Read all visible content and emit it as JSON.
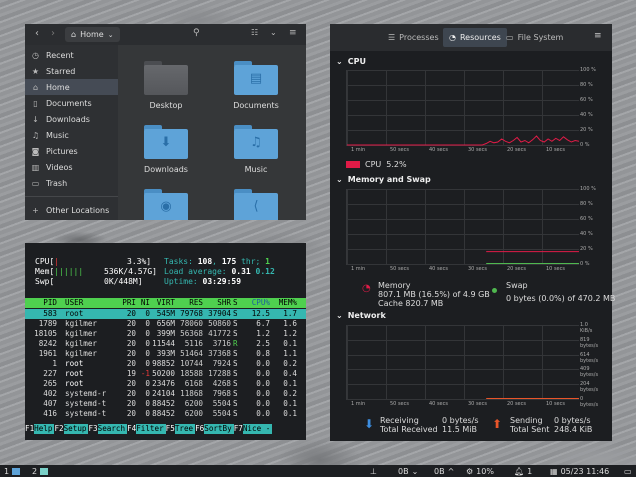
{
  "files": {
    "path_label": "Home",
    "sidebar": [
      {
        "label": "Recent",
        "icon": "clock-icon"
      },
      {
        "label": "Starred",
        "icon": "star-icon"
      },
      {
        "label": "Home",
        "icon": "home-icon",
        "selected": true
      },
      {
        "label": "Documents",
        "icon": "document-icon"
      },
      {
        "label": "Downloads",
        "icon": "download-icon"
      },
      {
        "label": "Music",
        "icon": "music-icon"
      },
      {
        "label": "Pictures",
        "icon": "camera-icon"
      },
      {
        "label": "Videos",
        "icon": "video-icon"
      },
      {
        "label": "Trash",
        "icon": "trash-icon"
      }
    ],
    "other_locations": "Other Locations",
    "folders": [
      {
        "label": "Desktop",
        "glyph": ""
      },
      {
        "label": "Documents",
        "glyph": "▤"
      },
      {
        "label": "Downloads",
        "glyph": "⬇"
      },
      {
        "label": "Music",
        "glyph": "♫"
      },
      {
        "label": "",
        "glyph": "◉"
      },
      {
        "label": "",
        "glyph": "⟨"
      }
    ],
    "colors": {
      "folder": "#5ea3d8",
      "folder_tab": "#4a8ec4",
      "desktop": "#5a5c60"
    }
  },
  "monitor": {
    "tabs": [
      "Processes",
      "Resources",
      "File System"
    ],
    "active_tab": "Resources",
    "sections": {
      "cpu": "CPU",
      "mem": "Memory and Swap",
      "net": "Network"
    },
    "pct_ticks": [
      "100 %",
      "80 %",
      "60 %",
      "40 %",
      "20 %",
      "0 %"
    ],
    "net_ticks": [
      "1.0 KiB/s",
      "819 bytes/s",
      "614 bytes/s",
      "409 bytes/s",
      "204 bytes/s",
      "0 bytes/s"
    ],
    "time_ticks": [
      "1 min",
      "50 secs",
      "40 secs",
      "30 secs",
      "20 secs",
      "10 secs"
    ],
    "cpu_legend": {
      "name": "CPU",
      "value": "5.2%",
      "color": "#e01b47"
    },
    "cpu_values": [
      0,
      0,
      0,
      0,
      0,
      0,
      0,
      0,
      0,
      0,
      0,
      0,
      0,
      0,
      0,
      0,
      0,
      0,
      0,
      0,
      0,
      0,
      0,
      0,
      0,
      0,
      0,
      0,
      0,
      0,
      0,
      0,
      0,
      0,
      0,
      0,
      2,
      5,
      3,
      4,
      8,
      5,
      3,
      6,
      10,
      4,
      6,
      3,
      7,
      12,
      6,
      4,
      8,
      5,
      9,
      6,
      11,
      7,
      4,
      6,
      5
    ],
    "memory": {
      "label": "Memory",
      "detail": "807.1 MB (16.5%) of 4.9 GB",
      "cache": "Cache 820.7 MB",
      "color": "#e01b47"
    },
    "swap": {
      "label": "Swap",
      "detail": "0 bytes (0.0%) of 470.2 MB",
      "color": "#4fb84f"
    },
    "memory_pct": 16.5,
    "network": {
      "recv_label": "Receiving",
      "recv_val": "0 bytes/s",
      "recv_total_label": "Total Received",
      "recv_total": "11.5 MiB",
      "send_label": "Sending",
      "send_val": "0 bytes/s",
      "send_total_label": "Total Sent",
      "send_total": "248.4 KiB"
    }
  },
  "htop": {
    "cpu_label": "CPU[",
    "cpu_bar": "|",
    "cpu_val": "3.3%]",
    "mem_label": "Mem[",
    "mem_bar": "||||||",
    "mem_val": "536K/4.57G]",
    "swp_label": "Swp[",
    "swp_val": "0K/448M]",
    "tasks_label": "Tasks: ",
    "tasks_a": "108",
    "tasks_sep": ", ",
    "tasks_b": "175",
    "tasks_mid": " thr; ",
    "tasks_c": "1",
    "load_label": "Load average: ",
    "load_a": "0.31",
    "load_b": "0.12",
    "uptime_label": "Uptime: ",
    "uptime": "03:29:59",
    "headers": [
      "PID",
      "USER",
      "PRI",
      "NI",
      "VIRT",
      "RES",
      "SHR",
      "S",
      "CPU%",
      "MEM%"
    ],
    "rows": [
      [
        "583",
        "root",
        "20",
        "0",
        "545M",
        "79768",
        "37904",
        "S",
        "12.5",
        "1.7"
      ],
      [
        "1789",
        "kgilmer",
        "20",
        "0",
        "656M",
        "78060",
        "50860",
        "S",
        "6.7",
        "1.6"
      ],
      [
        "18105",
        "kgilmer",
        "20",
        "0",
        "399M",
        "56368",
        "41772",
        "S",
        "1.2",
        "1.2"
      ],
      [
        "8242",
        "kgilmer",
        "20",
        "0",
        "11544",
        "5116",
        "3716",
        "R",
        "2.5",
        "0.1"
      ],
      [
        "1961",
        "kgilmer",
        "20",
        "0",
        "393M",
        "51464",
        "37368",
        "S",
        "0.8",
        "1.1"
      ],
      [
        "1",
        "root",
        "20",
        "0",
        "98852",
        "10744",
        "7924",
        "S",
        "0.0",
        "0.2"
      ],
      [
        "227",
        "root",
        "19",
        "-1",
        "50200",
        "18588",
        "17288",
        "S",
        "0.0",
        "0.4"
      ],
      [
        "265",
        "root",
        "20",
        "0",
        "23476",
        "6168",
        "4268",
        "S",
        "0.0",
        "0.1"
      ],
      [
        "402",
        "systemd-r",
        "20",
        "0",
        "24104",
        "11868",
        "7968",
        "S",
        "0.0",
        "0.2"
      ],
      [
        "407",
        "systemd-t",
        "20",
        "0",
        "88452",
        "6200",
        "5504",
        "S",
        "0.0",
        "0.1"
      ],
      [
        "416",
        "systemd-t",
        "20",
        "0",
        "88452",
        "6200",
        "5504",
        "S",
        "0.0",
        "0.1"
      ]
    ],
    "fkeys": [
      [
        "F1",
        "Help"
      ],
      [
        "F2",
        "Setup"
      ],
      [
        "F3",
        "Search"
      ],
      [
        "F4",
        "Filter"
      ],
      [
        "F5",
        "Tree"
      ],
      [
        "F6",
        "SortBy"
      ],
      [
        "F7",
        "Nice -"
      ]
    ]
  },
  "taskbar": {
    "ws1": "1",
    "ws2": "2",
    "net_down": "0B",
    "net_up": "0B",
    "cpu": "10%",
    "notif": "1",
    "datetime": "05/23 11:46"
  }
}
